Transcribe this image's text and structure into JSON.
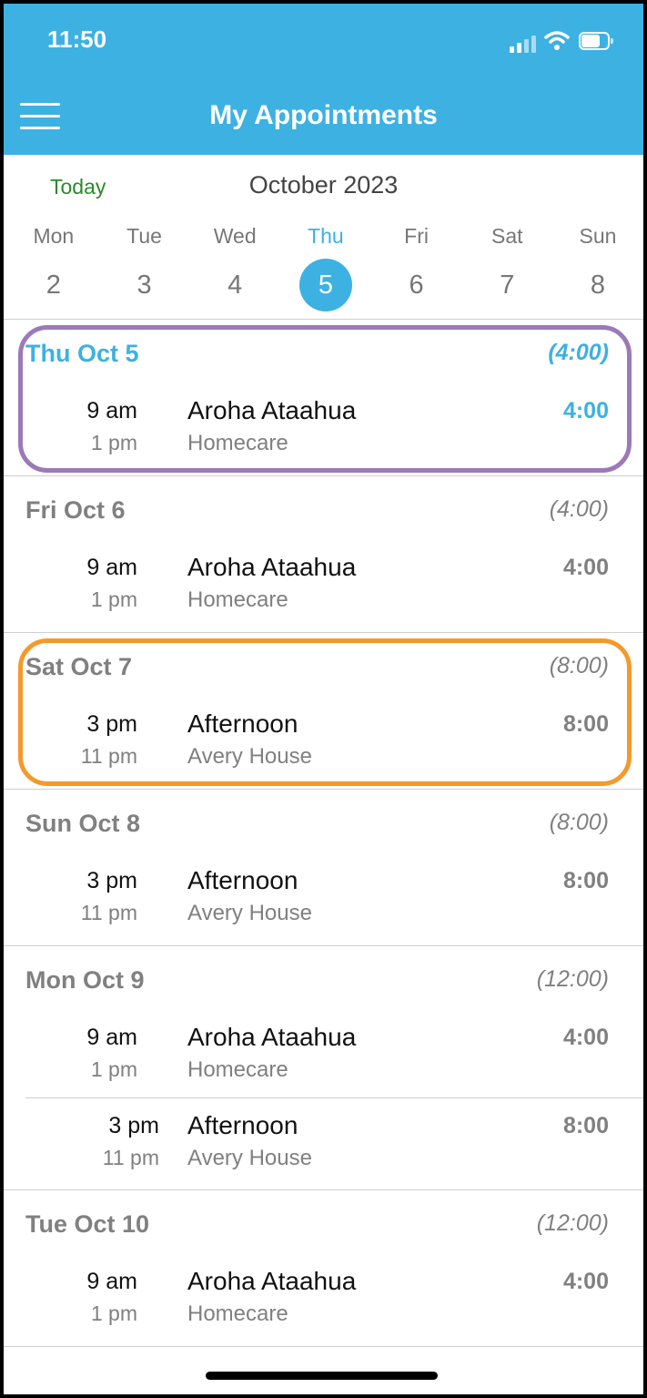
{
  "status_bar": {
    "time": "11:50",
    "icons": [
      "signal-icon",
      "wifi-icon",
      "battery-icon"
    ]
  },
  "header": {
    "title": "My Appointments",
    "menu_icon": "hamburger-menu-icon"
  },
  "calendar": {
    "today_label": "Today",
    "month_label": "October 2023",
    "selected_index": 3,
    "days": [
      {
        "name": "Mon",
        "num": "2"
      },
      {
        "name": "Tue",
        "num": "3"
      },
      {
        "name": "Wed",
        "num": "4"
      },
      {
        "name": "Thu",
        "num": "5"
      },
      {
        "name": "Fri",
        "num": "6"
      },
      {
        "name": "Sat",
        "num": "7"
      },
      {
        "name": "Sun",
        "num": "8"
      }
    ]
  },
  "sections": [
    {
      "date": "Thu Oct 5",
      "total": "(4:00)",
      "current": true,
      "appointments": [
        {
          "start": "9 am",
          "end": "1 pm",
          "name": "Aroha Ataahua",
          "sub": "Homecare",
          "duration": "4:00"
        }
      ]
    },
    {
      "date": "Fri Oct 6",
      "total": "(4:00)",
      "appointments": [
        {
          "start": "9 am",
          "end": "1 pm",
          "name": "Aroha Ataahua",
          "sub": "Homecare",
          "duration": "4:00"
        }
      ]
    },
    {
      "date": "Sat Oct 7",
      "total": "(8:00)",
      "appointments": [
        {
          "start": "3 pm",
          "end": "11 pm",
          "name": "Afternoon",
          "sub": "Avery House",
          "duration": "8:00"
        }
      ]
    },
    {
      "date": "Sun Oct 8",
      "total": "(8:00)",
      "appointments": [
        {
          "start": "3 pm",
          "end": "11 pm",
          "name": "Afternoon",
          "sub": "Avery House",
          "duration": "8:00"
        }
      ]
    },
    {
      "date": "Mon Oct 9",
      "total": "(12:00)",
      "appointments": [
        {
          "start": "9 am",
          "end": "1 pm",
          "name": "Aroha Ataahua",
          "sub": "Homecare",
          "duration": "4:00"
        },
        {
          "start": "3 pm",
          "end": "11 pm",
          "name": "Afternoon",
          "sub": "Avery House",
          "duration": "8:00"
        }
      ]
    },
    {
      "date": "Tue Oct 10",
      "total": "(12:00)",
      "appointments": [
        {
          "start": "9 am",
          "end": "1 pm",
          "name": "Aroha Ataahua",
          "sub": "Homecare",
          "duration": "4:00"
        }
      ]
    }
  ],
  "colors": {
    "header": "#3db1e2",
    "accent": "#3db1e2",
    "today": "#2a8a2a",
    "highlight_purple": "#9b7ab8",
    "highlight_orange": "#f39a2b"
  },
  "highlights": [
    {
      "section_index": 0,
      "color": "#9b7ab8"
    },
    {
      "section_index": 2,
      "color": "#f39a2b"
    }
  ]
}
